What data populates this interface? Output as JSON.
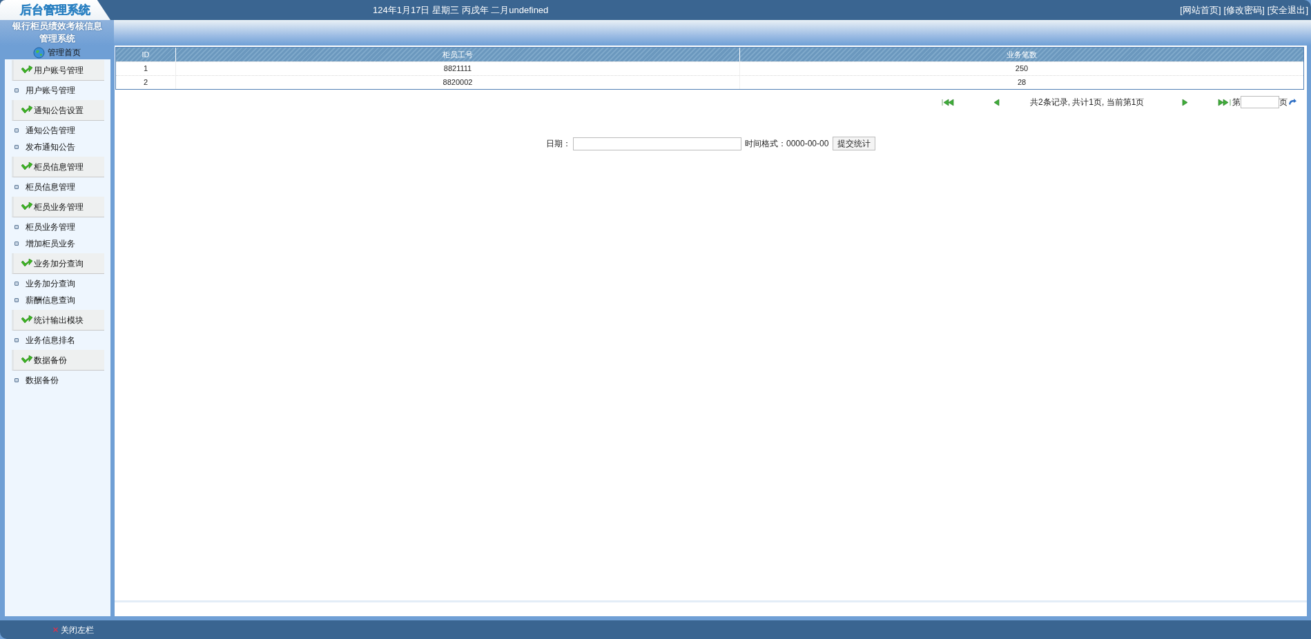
{
  "header": {
    "logo": "后台管理系统",
    "date": "124年1月17日 星期三 丙戌年 二月undefined",
    "links": [
      "[网站首页]",
      "[修改密码]",
      "[安全退出]"
    ]
  },
  "sidebar": {
    "title": "银行柜员绩效考核信息管理系统",
    "home": "管理首页",
    "sections": [
      {
        "title": "用户账号管理",
        "items": [
          "用户账号管理"
        ]
      },
      {
        "title": "通知公告设置",
        "items": [
          "通知公告管理",
          "发布通知公告"
        ]
      },
      {
        "title": "柜员信息管理",
        "items": [
          "柜员信息管理"
        ]
      },
      {
        "title": "柜员业务管理",
        "items": [
          "柜员业务管理",
          "增加柜员业务"
        ]
      },
      {
        "title": "业务加分查询",
        "items": [
          "业务加分查询",
          "薪酬信息查询"
        ]
      },
      {
        "title": "统计输出模块",
        "items": [
          "业务信息排名"
        ]
      },
      {
        "title": "数据备份",
        "items": [
          "数据备份"
        ]
      }
    ]
  },
  "table": {
    "columns": [
      "ID",
      "柜员工号",
      "业务笔数"
    ],
    "rows": [
      [
        "1",
        "8821111",
        "250"
      ],
      [
        "2",
        "8820002",
        "28"
      ]
    ]
  },
  "pager": {
    "summary": "共2条记录, 共计1页, 当前第1页",
    "page_prefix": "第",
    "page_suffix": "页"
  },
  "date_form": {
    "label": "日期：",
    "hint": "时间格式：0000-00-00",
    "submit": "提交统计"
  },
  "footer": {
    "close_sidebar": "关闭左栏"
  }
}
